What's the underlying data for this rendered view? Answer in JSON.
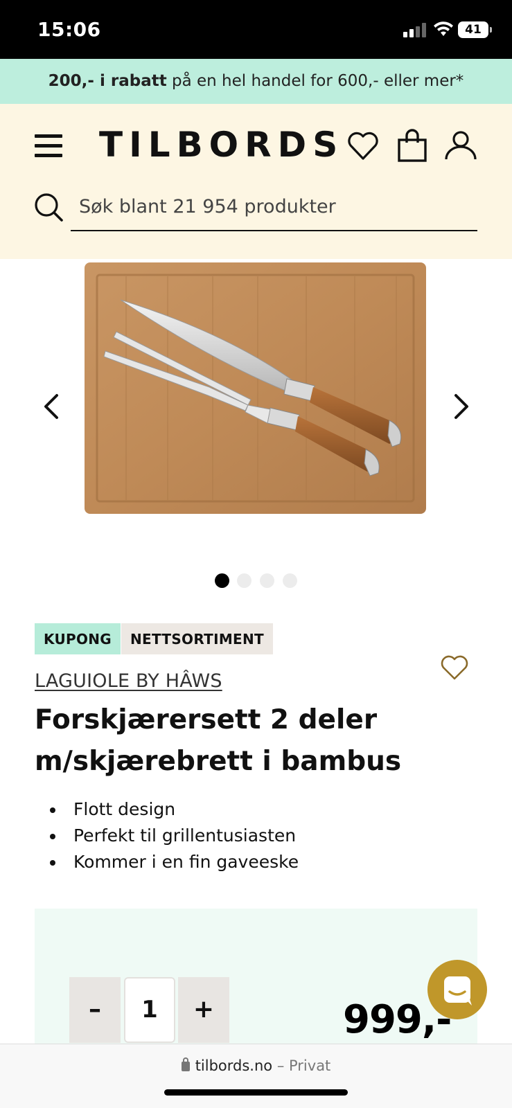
{
  "status_bar": {
    "time": "15:06",
    "battery": "41"
  },
  "promo": {
    "bold": "200,- i rabatt",
    "rest": " på en hel handel for 600,- eller mer*"
  },
  "header": {
    "logo": "TILBORDS",
    "search_placeholder": "Søk blant 21 954 produkter"
  },
  "gallery": {
    "slide_count": 4,
    "active_slide": 1
  },
  "product": {
    "badges": [
      "KUPONG",
      "NETTSORTIMENT"
    ],
    "brand": "LAGUIOLE BY HÂWS",
    "title": "Forskjærersett 2 deler m/skjærebrett i bambus",
    "features": [
      "Flott design",
      "Perfekt til grillentusiasten",
      "Kommer i en fin gaveeske"
    ]
  },
  "purchase": {
    "minus_label": "–",
    "plus_label": "+",
    "quantity": "1",
    "price": "999,-"
  },
  "browser": {
    "domain": "tilbords.no",
    "separator": " – ",
    "mode": "Privat"
  },
  "colors": {
    "promo_bg": "#bdeedd",
    "header_bg": "#fdf6e3",
    "badge_kupong_bg": "#b6ecd9",
    "badge_netto_bg": "#ede8e3",
    "buy_box_bg": "#effaf5",
    "chat_button": "#c0972a",
    "wishlist_heart": "#8a6a2a"
  },
  "icons": [
    "menu-icon",
    "heart-icon",
    "cart-icon",
    "user-icon",
    "search-icon",
    "chevron-left-icon",
    "chevron-right-icon",
    "chat-icon",
    "lock-icon"
  ]
}
